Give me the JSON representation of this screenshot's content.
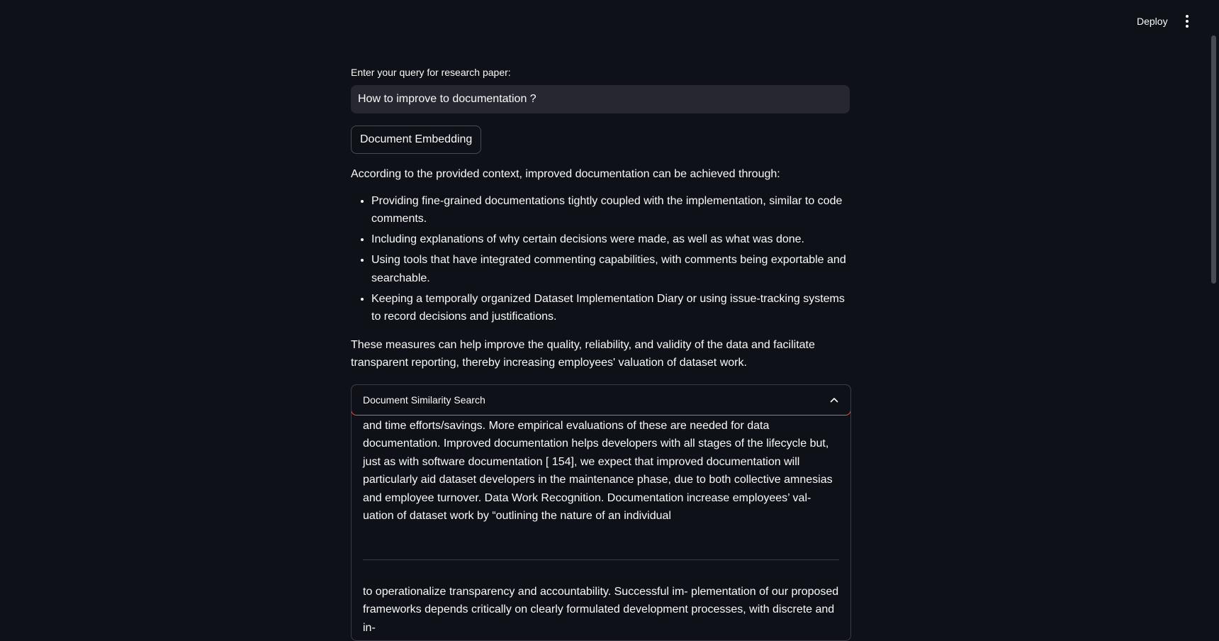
{
  "header": {
    "deploy_label": "Deploy",
    "menu_icon": "kebab-menu-icon"
  },
  "query": {
    "label": "Enter your query for research paper:",
    "value": "How to improve to documentation ?"
  },
  "embed_button": {
    "label": "Document Embedding"
  },
  "answer": {
    "intro": "According to the provided context, improved documentation can be achieved through:",
    "bullets": [
      "Providing fine-grained documentations tightly coupled with the implementation, similar to code comments.",
      "Including explanations of why certain decisions were made, as well as what was done.",
      "Using tools that have integrated commenting capabilities, with comments being exportable and searchable.",
      "Keeping a temporally organized Dataset Implementation Diary or using issue-tracking systems to record decisions and justifications."
    ],
    "conclusion": "These measures can help improve the quality, reliability, and validity of the data and facilitate transparent reporting, thereby increasing employees' valuation of dataset work."
  },
  "expander": {
    "title": "Document Similarity Search",
    "chevron_icon": "chevron-up-icon",
    "docs": [
      "and time efforts/savings. More empirical evaluations of these are needed for data documentation. Improved documentation helps developers with all stages of the lifecycle but, just as with software documentation [ 154], we expect that improved documentation will particularly aid dataset developers in the maintenance phase, due to both collective amnesias and employee turnover. Data Work Recognition. Documentation increase employees’ val- uation of dataset work by “outlining the nature of an individual",
      "to operationalize transparency and accountability. Successful im- plementation of our proposed frameworks depends critically on clearly formulated development processes, with discrete and in-"
    ]
  }
}
